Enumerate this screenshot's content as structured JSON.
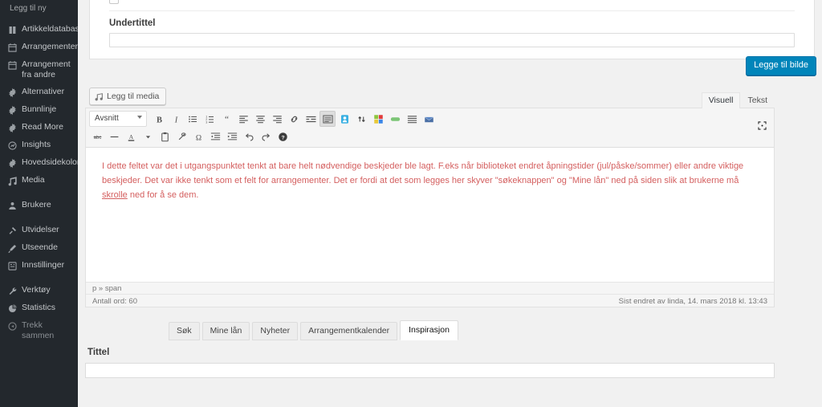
{
  "sidebar": {
    "submenu_top_label": "Legg til ny",
    "items": [
      {
        "label": "Artikkeldatabase",
        "icon": "book-icon",
        "dim": false,
        "gap_before": false
      },
      {
        "label": "Arrangementer",
        "icon": "calendar-icon",
        "dim": false,
        "gap_before": false
      },
      {
        "label": "Arrangement fra andre",
        "icon": "calendar-icon",
        "dim": false,
        "gap_before": false
      },
      {
        "label": "Alternativer",
        "icon": "gear-icon",
        "dim": false,
        "gap_before": false
      },
      {
        "label": "Bunnlinje",
        "icon": "gear-icon",
        "dim": false,
        "gap_before": false
      },
      {
        "label": "Read More",
        "icon": "gear-icon",
        "dim": false,
        "gap_before": false
      },
      {
        "label": "Insights",
        "icon": "chart-icon",
        "dim": false,
        "gap_before": false
      },
      {
        "label": "Hovedsidekolonne",
        "icon": "gear-icon",
        "dim": false,
        "gap_before": false
      },
      {
        "label": "Media",
        "icon": "media-icon",
        "dim": false,
        "gap_before": false
      },
      {
        "label": "Brukere",
        "icon": "users-icon",
        "dim": false,
        "gap_before": true
      },
      {
        "label": "Utvidelser",
        "icon": "plugin-icon",
        "dim": false,
        "gap_before": true
      },
      {
        "label": "Utseende",
        "icon": "brush-icon",
        "dim": false,
        "gap_before": false
      },
      {
        "label": "Innstillinger",
        "icon": "sliders-icon",
        "dim": false,
        "gap_before": false
      },
      {
        "label": "Verktøy",
        "icon": "wrench-icon",
        "dim": false,
        "gap_before": true
      },
      {
        "label": "Statistics",
        "icon": "pie-chart-icon",
        "dim": false,
        "gap_before": false
      },
      {
        "label": "Trekk sammen",
        "icon": "collapse-icon",
        "dim": true,
        "gap_before": false
      }
    ]
  },
  "metabox": {
    "subtitle_label": "Undertittel",
    "subtitle_value": "",
    "subtitle_placeholder": ""
  },
  "buttons": {
    "add_image": "Legge til bilde"
  },
  "editor": {
    "add_media_label": "Legg til media",
    "tabs": [
      {
        "label": "Visuell",
        "active": true
      },
      {
        "label": "Tekst",
        "active": false
      }
    ],
    "format_select_value": "Avsnitt",
    "toolbar_row1": [
      {
        "name": "bold-icon",
        "glyph": "B"
      },
      {
        "name": "italic-icon",
        "glyph": "I"
      },
      {
        "name": "bulleted-list-icon",
        "glyph": "≡"
      },
      {
        "name": "numbered-list-icon",
        "glyph": "≣"
      },
      {
        "name": "blockquote-icon",
        "glyph": "“"
      },
      {
        "name": "align-left-icon",
        "glyph": "≡"
      },
      {
        "name": "align-center-icon",
        "glyph": "≡"
      },
      {
        "name": "align-right-icon",
        "glyph": "≡"
      },
      {
        "name": "insert-link-icon",
        "glyph": "🔗"
      },
      {
        "name": "read-more-icon",
        "glyph": "☰"
      },
      {
        "name": "toolbar-toggle-icon",
        "glyph": "⌸"
      },
      {
        "name": "anchor-icon",
        "glyph": "⚓"
      },
      {
        "name": "vertical-arrows-icon",
        "glyph": "⇅"
      },
      {
        "name": "color-blocks-icon",
        "glyph": "▦"
      },
      {
        "name": "green-bar-icon",
        "glyph": "▬"
      },
      {
        "name": "list-lines-icon",
        "glyph": "☰"
      },
      {
        "name": "mailbox-icon",
        "glyph": "✉"
      }
    ],
    "toolbar_row2": [
      {
        "name": "strikethrough-icon",
        "glyph": "abc"
      },
      {
        "name": "horizontal-rule-icon",
        "glyph": "—"
      },
      {
        "name": "text-color-icon",
        "glyph": "A"
      },
      {
        "name": "text-color-dropdown-icon",
        "glyph": "▾"
      },
      {
        "name": "paste-as-text-icon",
        "glyph": "📋"
      },
      {
        "name": "clear-formatting-icon",
        "glyph": "⊘"
      },
      {
        "name": "special-character-icon",
        "glyph": "Ω"
      },
      {
        "name": "outdent-icon",
        "glyph": "⇤"
      },
      {
        "name": "indent-icon",
        "glyph": "⇥"
      },
      {
        "name": "undo-icon",
        "glyph": "↶"
      },
      {
        "name": "redo-icon",
        "glyph": "↷"
      },
      {
        "name": "help-icon",
        "glyph": "?"
      }
    ],
    "fullscreen_icon": "distraction-free-icon",
    "content_paragraph": "I dette feltet var det i utgangspunktet tenkt at bare helt nødvendige beskjeder ble lagt. F.eks når biblioteket endret åpningstider (jul/påske/sommer) eller andre viktige beskjeder.  Det var ikke tenkt som et felt for arrangementer. Det er fordi at det som legges her skyver \"søkeknappen\" og \"Mine lån\"  ned på siden slik at brukerne må ",
    "content_underlined_word": "skrolle",
    "content_paragraph_tail": " ned for å se dem.",
    "path": "p » span",
    "word_count": "Antall ord: 60",
    "last_edited": "Sist endret av linda, 14. mars 2018 kl. 13:43",
    "text_color": "#d45f5f"
  },
  "bottom_tabs": [
    {
      "label": "Søk",
      "active": false
    },
    {
      "label": "Mine lån",
      "active": false
    },
    {
      "label": "Nyheter",
      "active": false
    },
    {
      "label": "Arrangementkalender",
      "active": false
    },
    {
      "label": "Inspirasjon",
      "active": true
    }
  ],
  "bottom_panel": {
    "title_label": "Tittel",
    "title_value": "",
    "title_placeholder": ""
  },
  "colors": {
    "sidebar_bg": "#23282d",
    "accent_blue": "#0085ba",
    "page_bg": "#f1f1f1"
  }
}
